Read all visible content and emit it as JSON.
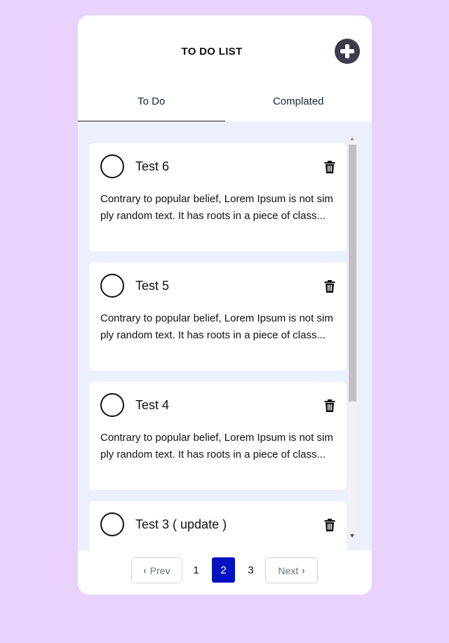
{
  "header": {
    "title": "TO DO LIST",
    "add_icon": "plus-circle-icon"
  },
  "tabs": [
    {
      "label": "To Do",
      "active": true
    },
    {
      "label": "Complated",
      "active": false
    }
  ],
  "items": [
    {
      "title": "Test 6",
      "description": "Contrary to popular belief, Lorem Ipsum is not simply random text. It has roots in a piece of class...",
      "icon": "trash-icon"
    },
    {
      "title": "Test 5",
      "description": "Contrary to popular belief, Lorem Ipsum is not simply random text. It has roots in a piece of class...",
      "icon": "trash-icon"
    },
    {
      "title": "Test 4",
      "description": "Contrary to popular belief, Lorem Ipsum is not simply random text. It has roots in a piece of class...",
      "icon": "trash-icon"
    },
    {
      "title": "Test 3 ( update )",
      "description": "",
      "icon": "trash-icon"
    }
  ],
  "pagination": {
    "prev_label": "Prev",
    "next_label": "Next",
    "pages": [
      "1",
      "2",
      "3"
    ],
    "current_page": "2"
  },
  "colors": {
    "background": "#e9d3fd",
    "list_background": "#ecf0fe",
    "active_page": "#0013c2",
    "add_button": "#3c3d4c"
  }
}
